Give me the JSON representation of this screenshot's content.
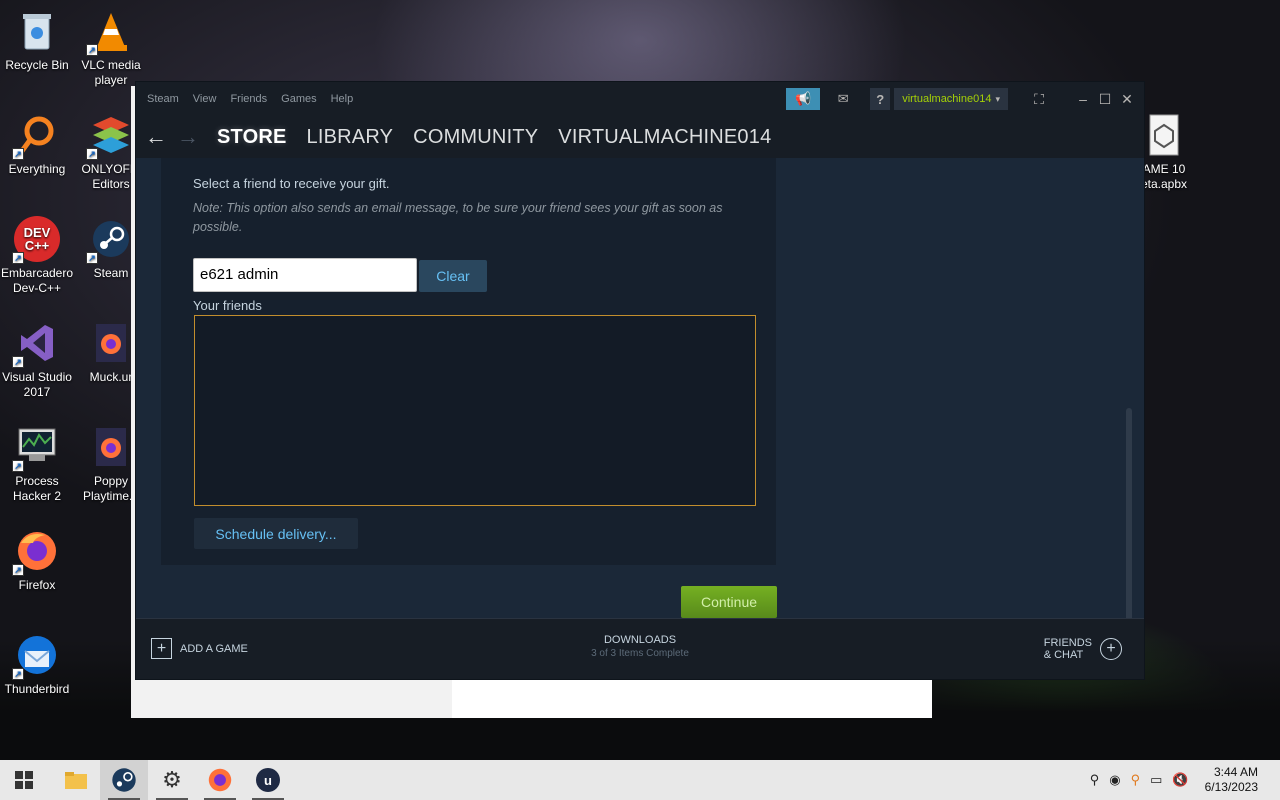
{
  "desktop": {
    "icons": [
      {
        "label": "Recycle Bin",
        "icon": "recycle-bin-icon"
      },
      {
        "label": "VLC media player",
        "icon": "vlc-icon"
      },
      {
        "label": "Everything",
        "icon": "everything-search-icon"
      },
      {
        "label": "ONLYOFFI Editors",
        "icon": "onlyoffice-icon"
      },
      {
        "label": "Embarcadero Dev-C++",
        "icon": "devcpp-icon",
        "badge": "DEV C++"
      },
      {
        "label": "Steam",
        "icon": "steam-icon"
      },
      {
        "label": "Visual Studio 2017",
        "icon": "visual-studio-icon"
      },
      {
        "label": "Muck.ur",
        "icon": "firefox-shortcut-icon"
      },
      {
        "label": "Process Hacker 2",
        "icon": "process-hacker-icon"
      },
      {
        "label": "Poppy Playtime.u",
        "icon": "firefox-shortcut-icon"
      },
      {
        "label": "Firefox",
        "icon": "firefox-icon"
      },
      {
        "label": "Thunderbird",
        "icon": "thunderbird-icon"
      },
      {
        "label": "AME 10 eta.apbx",
        "icon": "file-icon"
      }
    ]
  },
  "steam": {
    "menu": [
      "Steam",
      "View",
      "Friends",
      "Games",
      "Help"
    ],
    "help_label": "?",
    "account": "virtualmachine014",
    "nav": {
      "store": "STORE",
      "library": "LIBRARY",
      "community": "COMMUNITY",
      "profile": "VIRTUALMACHINE014"
    },
    "gift": {
      "prompt": "Select a friend to receive your gift.",
      "note": "Note: This option also sends an email message, to be sure your friend sees your gift as soon as possible.",
      "search_value": "e621 admin",
      "clear_label": "Clear",
      "friends_label": "Your friends",
      "schedule_label": "Schedule delivery...",
      "continue_label": "Continue"
    },
    "bottom": {
      "add_game": "ADD A GAME",
      "downloads_title": "DOWNLOADS",
      "downloads_status": "3 of 3 Items Complete",
      "friends_line1": "FRIENDS",
      "friends_line2": "& CHAT"
    }
  },
  "taskbar": {
    "time": "3:44 AM",
    "date": "6/13/2023"
  },
  "colors": {
    "steam_bg": "#1b2838",
    "accent_blue": "#66c0f4",
    "continue_green": "#75b022",
    "friends_border": "#c28e2d",
    "account_green": "#a4d007"
  }
}
